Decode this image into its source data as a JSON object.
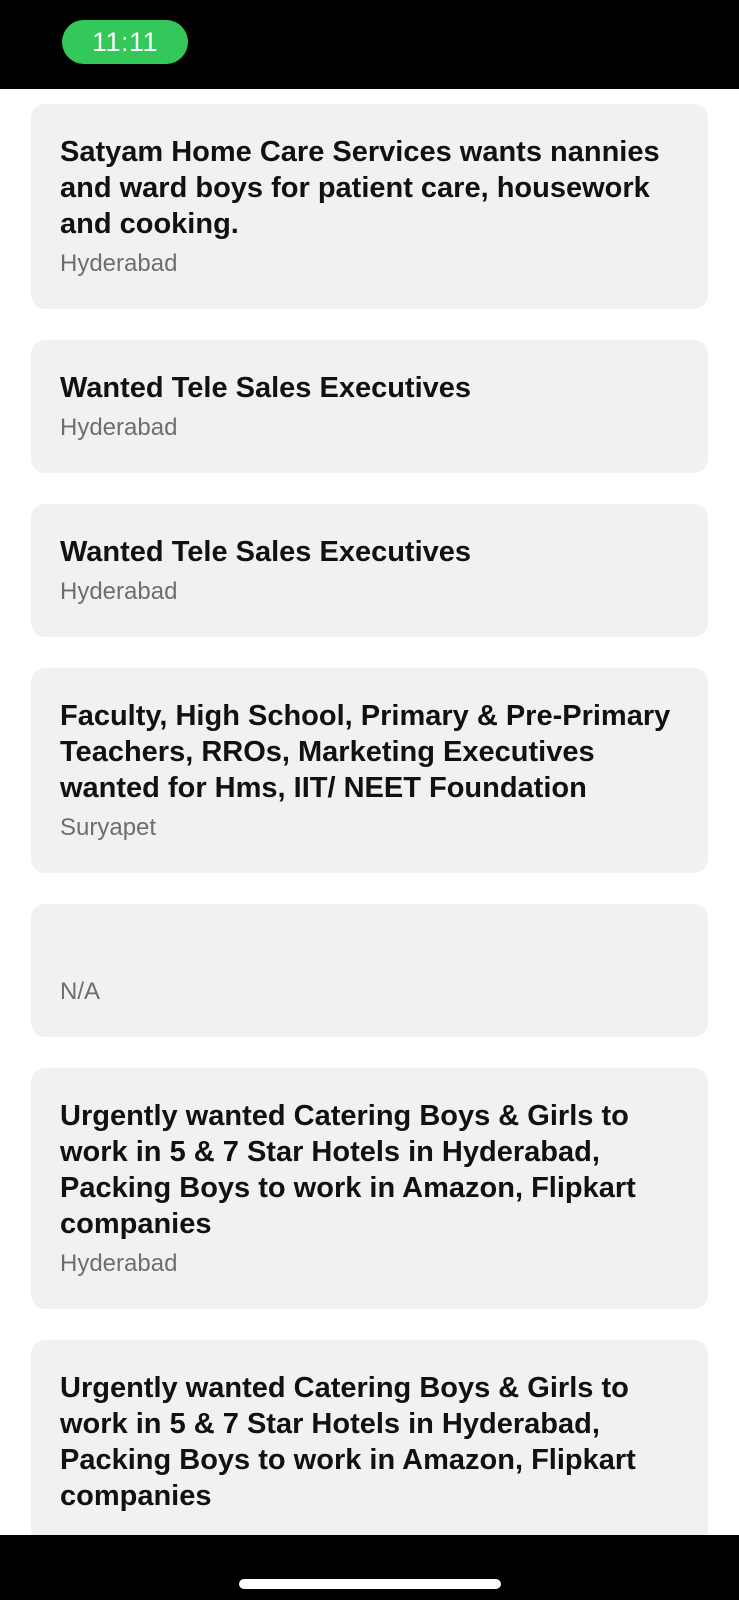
{
  "status_bar": {
    "time": "11:11"
  },
  "listings": [
    {
      "title": "Satyam Home Care Services wants nannies and ward boys for patient care, housework and cooking.",
      "location": "Hyderabad"
    },
    {
      "title": "Wanted Tele Sales Executives",
      "location": "Hyderabad"
    },
    {
      "title": "Wanted Tele Sales Executives",
      "location": "Hyderabad"
    },
    {
      "title": "Faculty, High School, Primary & Pre-Primary Teachers, RROs, Marketing Executives wanted for Hms, IIT/ NEET Foundation",
      "location": "Suryapet"
    },
    {
      "title": "",
      "location": "N/A"
    },
    {
      "title": "Urgently wanted Catering Boys & Girls to work in 5 & 7 Star Hotels in Hyderabad, Packing Boys to work in Amazon, Flipkart companies",
      "location": "Hyderabad"
    },
    {
      "title": "Urgently wanted Catering Boys & Girls to work in 5 & 7 Star Hotels in Hyderabad, Packing Boys to work in Amazon, Flipkart companies",
      "location": ""
    }
  ]
}
